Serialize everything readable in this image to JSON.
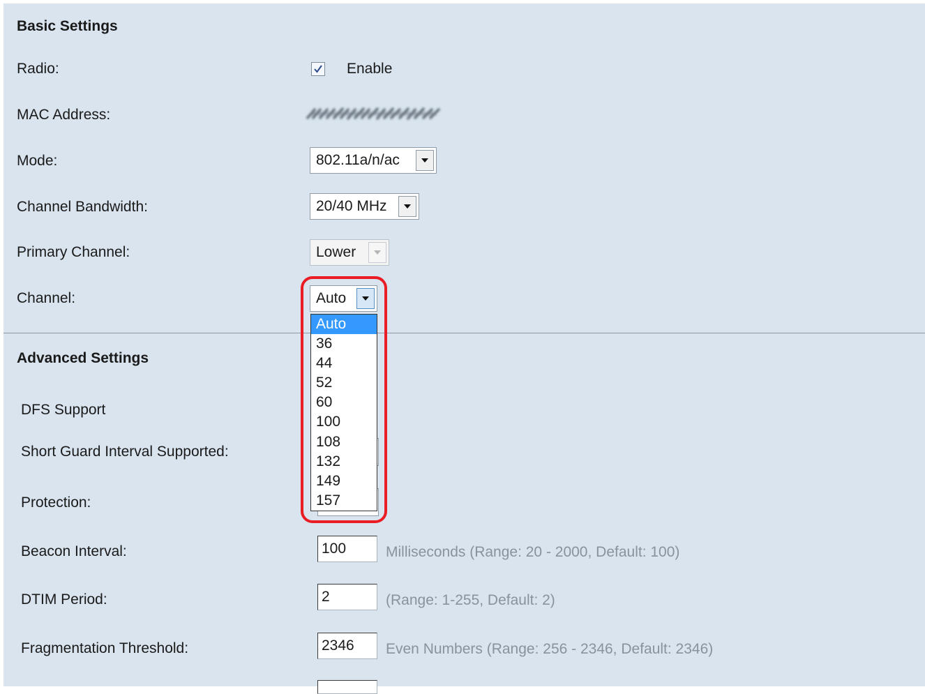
{
  "basic": {
    "title": "Basic Settings",
    "radio_label": "Radio:",
    "radio_enable_label": "Enable",
    "radio_checked": true,
    "mac_label": "MAC Address:",
    "mode_label": "Mode:",
    "mode_value": "802.11a/n/ac",
    "bandwidth_label": "Channel Bandwidth:",
    "bandwidth_value": "20/40 MHz",
    "primary_label": "Primary Channel:",
    "primary_value": "Lower",
    "channel_label": "Channel:",
    "channel_value": "Auto",
    "channel_options": [
      "Auto",
      "36",
      "44",
      "52",
      "60",
      "100",
      "108",
      "132",
      "149",
      "157"
    ]
  },
  "advanced": {
    "title": "Advanced Settings",
    "dfs_label": "DFS Support",
    "sgi_label": "Short Guard Interval Supported:",
    "protection_label": "Protection:",
    "beacon_label": "Beacon Interval:",
    "beacon_value": "100",
    "beacon_hint": "Milliseconds (Range: 20 - 2000, Default: 100)",
    "dtim_label": "DTIM Period:",
    "dtim_value": "2",
    "dtim_hint": "(Range: 1-255, Default: 2)",
    "frag_label": "Fragmentation Threshold:",
    "frag_value": "2346",
    "frag_hint": "Even Numbers (Range: 256 - 2346, Default: 2346)"
  },
  "colors": {
    "panel_bg": "#d9e4ef",
    "selection": "#3399ff",
    "highlight": "#ea1c24"
  },
  "icons": {
    "checkbox": "checkmark-icon",
    "select_arrow": "chevron-down-icon"
  }
}
